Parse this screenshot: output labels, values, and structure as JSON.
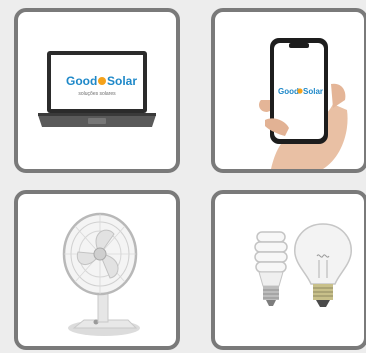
{
  "cards": [
    {
      "name": "laptop",
      "icon": "laptop-icon",
      "screen_logo": {
        "part1": "Good",
        "part2": "Solar",
        "tagline": "soluções solares"
      }
    },
    {
      "name": "smartphone",
      "icon": "smartphone-icon",
      "screen_logo": {
        "part1": "Good",
        "part2": "Solar"
      }
    },
    {
      "name": "fan",
      "icon": "fan-icon"
    },
    {
      "name": "light-bulbs",
      "icon": "light-bulb-icon"
    }
  ],
  "colors": {
    "background": "#ededed",
    "card_border": "#7a7a7a",
    "brand_blue": "#1e88c8",
    "brand_orange": "#f5a21b"
  }
}
